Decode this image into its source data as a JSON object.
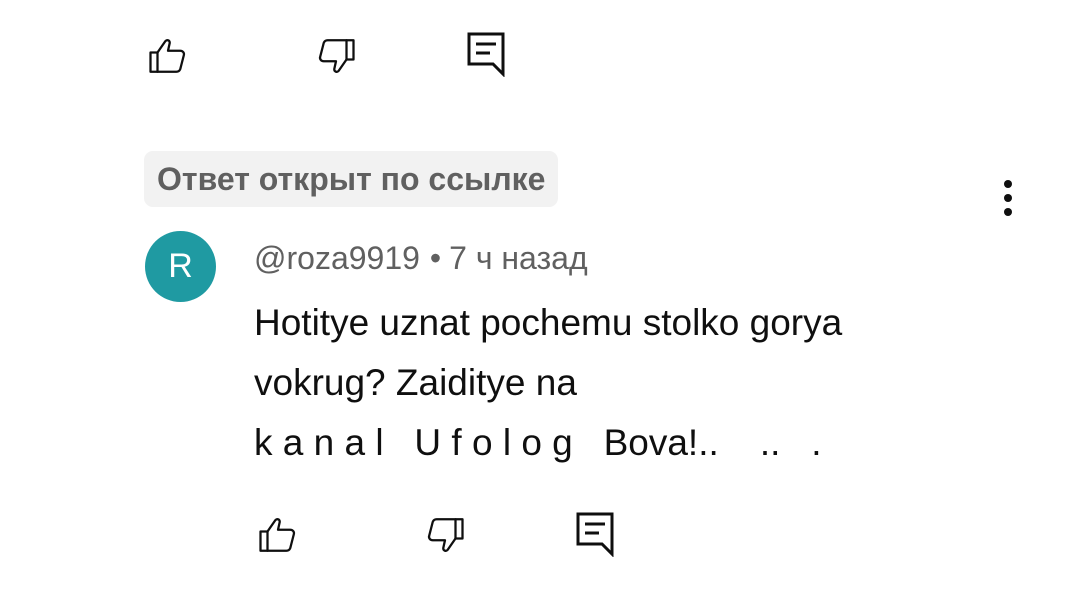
{
  "top_actions": {
    "like_icon": "thumbs-up-icon",
    "dislike_icon": "thumbs-down-icon",
    "reply_icon": "comment-reply-icon"
  },
  "badge": {
    "label": "Ответ открыт по ссылке"
  },
  "comment": {
    "avatar_letter": "R",
    "avatar_color": "#1f9aa2",
    "author": "@roza9919",
    "separator": "•",
    "time": "7 ч назад",
    "text_line1": "Hotitye uznat pochemu stolko gorya",
    "text_line2": "vokrug? Zaiditye na",
    "text_line3": "k a n a l   U f o l o g   Bova!..    ..   .",
    "menu_icon": "more-vert-icon"
  },
  "actions": {
    "like_icon": "thumbs-up-icon",
    "dislike_icon": "thumbs-down-icon",
    "reply_icon": "comment-reply-icon"
  }
}
